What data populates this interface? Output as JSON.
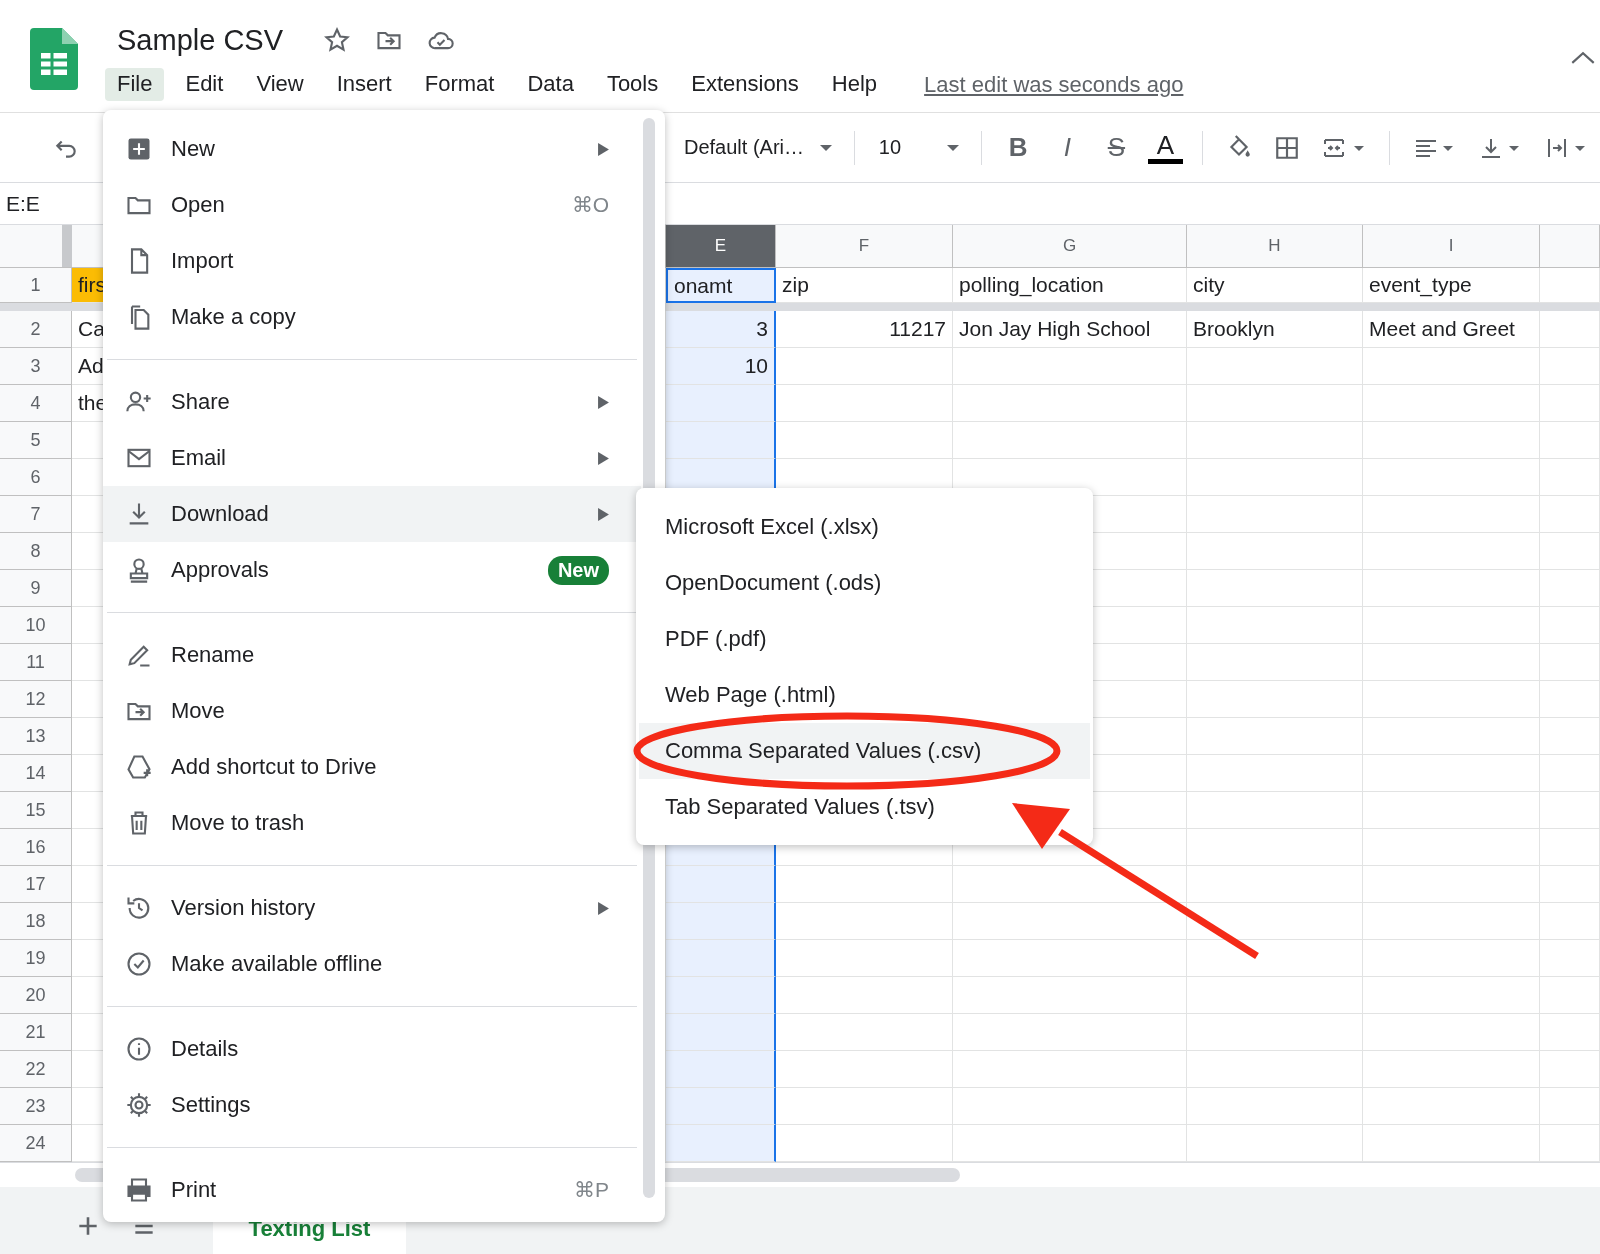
{
  "app": {
    "title": "Sample CSV",
    "last_edit": "Last edit was seconds ago"
  },
  "menubar": [
    {
      "label": "File",
      "selected": true
    },
    {
      "label": "Edit",
      "selected": false
    },
    {
      "label": "View",
      "selected": false
    },
    {
      "label": "Insert",
      "selected": false
    },
    {
      "label": "Format",
      "selected": false
    },
    {
      "label": "Data",
      "selected": false
    },
    {
      "label": "Tools",
      "selected": false
    },
    {
      "label": "Extensions",
      "selected": false
    },
    {
      "label": "Help",
      "selected": false
    }
  ],
  "toolbar": {
    "font": "Default (Ari…",
    "font_size": "10",
    "format_buttons": [
      {
        "label": "B",
        "kind": "bold"
      },
      {
        "label": "I",
        "kind": "italic"
      },
      {
        "label": "S",
        "kind": "strike"
      },
      {
        "label": "A",
        "kind": "color"
      }
    ]
  },
  "name_box": "E:E",
  "grid": {
    "columns": [
      {
        "label": "E",
        "selected": true
      },
      {
        "label": "F",
        "selected": false
      },
      {
        "label": "G",
        "selected": false
      },
      {
        "label": "H",
        "selected": false
      },
      {
        "label": "I",
        "selected": false
      }
    ],
    "rows": [
      {
        "number": "1",
        "color": "#fbbc04",
        "cells": {
          "a": "firs",
          "e": "onamt",
          "f": "zip",
          "g": "polling_location",
          "h": "city",
          "i": "event_type"
        }
      },
      {
        "number": "2",
        "cells": {
          "a": "Ca",
          "e": "3",
          "f": "11217",
          "g": "Jon Jay High School",
          "h": "Brooklyn",
          "i": "Meet and Greet"
        }
      },
      {
        "number": "3",
        "cells": {
          "a": "Ad",
          "e": "10"
        }
      },
      {
        "number": "4",
        "cells": {
          "a": "the"
        }
      },
      {
        "number": "5"
      },
      {
        "number": "6"
      },
      {
        "number": "7"
      },
      {
        "number": "8"
      },
      {
        "number": "9"
      },
      {
        "number": "10"
      },
      {
        "number": "11"
      },
      {
        "number": "12"
      },
      {
        "number": "13"
      },
      {
        "number": "14"
      },
      {
        "number": "15"
      },
      {
        "number": "16"
      },
      {
        "number": "17"
      },
      {
        "number": "18"
      },
      {
        "number": "19"
      },
      {
        "number": "20"
      },
      {
        "number": "21"
      },
      {
        "number": "22"
      },
      {
        "number": "23"
      },
      {
        "number": "24"
      }
    ]
  },
  "sheet_tabs": [
    {
      "label": "Texting List",
      "selected": true
    }
  ],
  "file_menu": {
    "sections": [
      {
        "items": [
          {
            "label": "New",
            "submenu": true,
            "selected": false
          },
          {
            "label": "Open",
            "shortcut": "⌘O",
            "submenu": false,
            "selected": false
          },
          {
            "label": "Import",
            "submenu": false,
            "selected": false
          },
          {
            "label": "Make a copy",
            "submenu": false,
            "selected": false
          }
        ]
      },
      {
        "items": [
          {
            "label": "Share",
            "submenu": true,
            "selected": false
          },
          {
            "label": "Email",
            "submenu": true,
            "selected": false
          },
          {
            "label": "Download",
            "submenu": true,
            "selected": true
          },
          {
            "label": "Approvals",
            "badge": "New",
            "submenu": false,
            "selected": false
          }
        ]
      },
      {
        "items": [
          {
            "label": "Rename",
            "submenu": false,
            "selected": false
          },
          {
            "label": "Move",
            "submenu": false,
            "selected": false
          },
          {
            "label": "Add shortcut to Drive",
            "submenu": false,
            "selected": false
          },
          {
            "label": "Move to trash",
            "submenu": false,
            "selected": false
          }
        ]
      },
      {
        "items": [
          {
            "label": "Version history",
            "submenu": true,
            "selected": false
          },
          {
            "label": "Make available offline",
            "submenu": false,
            "selected": false
          }
        ]
      },
      {
        "items": [
          {
            "label": "Details",
            "submenu": false,
            "selected": false
          },
          {
            "label": "Settings",
            "submenu": false,
            "selected": false
          }
        ]
      },
      {
        "items": [
          {
            "label": "Print",
            "shortcut": "⌘P",
            "submenu": false,
            "selected": false
          }
        ]
      }
    ]
  },
  "download_menu": [
    {
      "label": "Microsoft Excel (.xlsx)",
      "selected": false
    },
    {
      "label": "OpenDocument (.ods)",
      "selected": false
    },
    {
      "label": "PDF (.pdf)",
      "selected": false
    },
    {
      "label": "Web Page (.html)",
      "selected": false
    },
    {
      "label": "Comma Separated Values (.csv)",
      "selected": true
    },
    {
      "label": "Tab Separated Values (.tsv)",
      "selected": false
    }
  ]
}
